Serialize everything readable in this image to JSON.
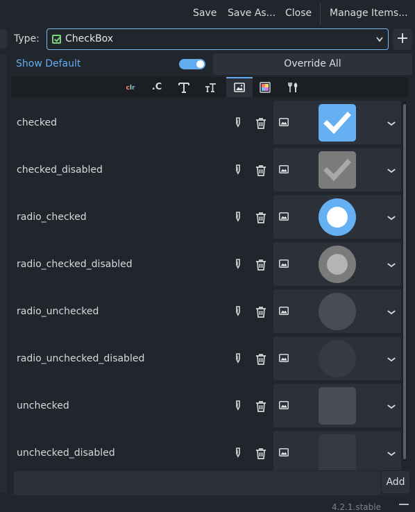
{
  "toolbar": {
    "save": "Save",
    "save_as": "Save As...",
    "close": "Close",
    "manage_items": "Manage Items..."
  },
  "type_row": {
    "label": "Type:",
    "selected": "CheckBox",
    "icon": "checkbox-icon",
    "add_icon": "plus-icon"
  },
  "options": {
    "show_default": "Show Default",
    "show_default_on": true,
    "override_all": "Override All"
  },
  "tabs": [
    {
      "name": "colors",
      "glyph": "clr",
      "active": false
    },
    {
      "name": "constants",
      "glyph": ".C",
      "active": false
    },
    {
      "name": "fonts",
      "glyph": "T",
      "active": false
    },
    {
      "name": "font-sizes",
      "glyph": "тT",
      "active": false
    },
    {
      "name": "icons",
      "glyph": "image-icon",
      "active": true
    },
    {
      "name": "styleboxes",
      "glyph": "stylebox-icon",
      "active": false
    },
    {
      "name": "type-settings",
      "glyph": "tools-icon",
      "active": false
    }
  ],
  "items": [
    {
      "name": "checked",
      "preview": "checked"
    },
    {
      "name": "checked_disabled",
      "preview": "checked-disabled"
    },
    {
      "name": "radio_checked",
      "preview": "radio-checked"
    },
    {
      "name": "radio_checked_disabled",
      "preview": "radio-checked-disabled"
    },
    {
      "name": "radio_unchecked",
      "preview": "radio-unchecked"
    },
    {
      "name": "radio_unchecked_disabled",
      "preview": "radio-unchecked-disabled"
    },
    {
      "name": "unchecked",
      "preview": "unchecked"
    },
    {
      "name": "unchecked_disabled",
      "preview": "unchecked-disabled"
    }
  ],
  "add_row": {
    "input_value": "",
    "button": "Add"
  },
  "status": {
    "version": "4.2.1.stable"
  },
  "colors": {
    "accent": "#63acef",
    "checked_fill": "#64b0f2",
    "disabled_fill": "#7b7b7b",
    "unchecked_fill": "#484c55"
  }
}
